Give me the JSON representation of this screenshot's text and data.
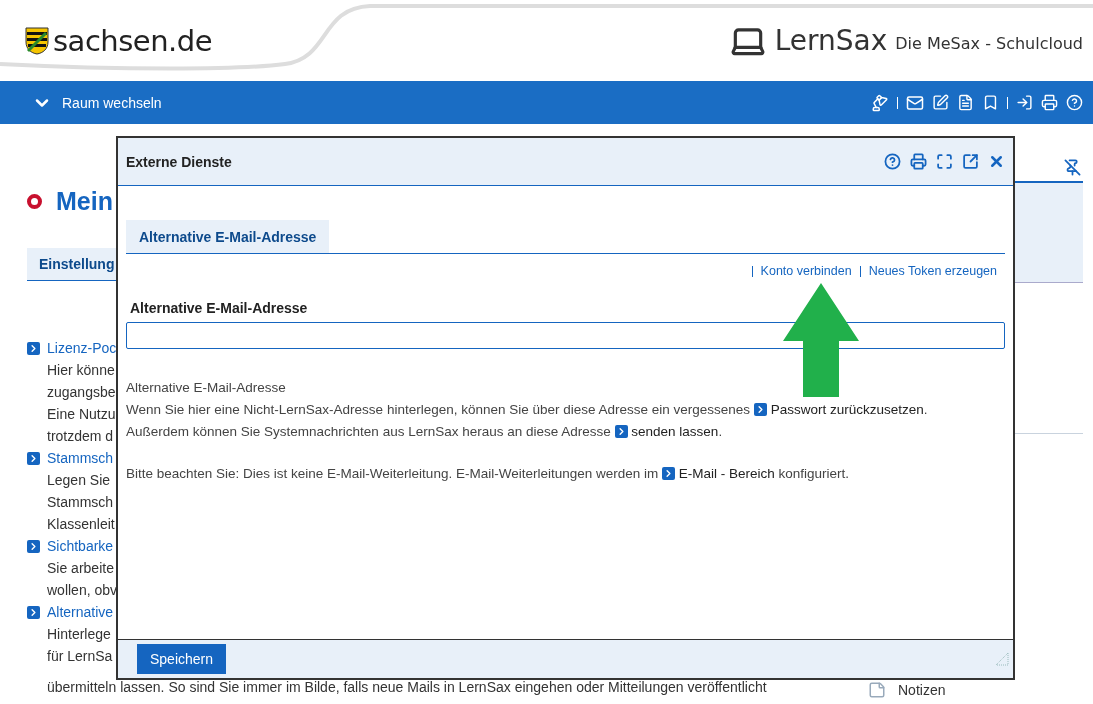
{
  "header": {
    "site_logo": "sachsen.de",
    "app_name": "LernSax",
    "tagline": "Die MeSax - Schulcloud"
  },
  "navbar": {
    "room_switch": "Raum wechseln"
  },
  "page": {
    "heading": "Mein",
    "tab": "Einstellung",
    "sections": [
      {
        "title": "Lizenz-Poc",
        "lines": [
          "Hier könne",
          "zugangsbe",
          "Eine Nutzu",
          "trotzdem d"
        ]
      },
      {
        "title": "Stammsch",
        "lines": [
          "Legen Sie",
          "Stammsch",
          "Klassenleit"
        ]
      },
      {
        "title": "Sichtbarke",
        "lines": [
          "Sie arbeite",
          "wollen, obv"
        ]
      },
      {
        "title": "Alternative",
        "lines": [
          "Hinterlege",
          "für LernSa"
        ]
      }
    ],
    "tail_line": "übermitteln lassen. So sind Sie immer im Bilde, falls neue Mails in LernSax eingehen oder Mitteilungen veröffentlicht",
    "sidebar": {
      "item": "Notizen"
    }
  },
  "dialog": {
    "title": "Externe Dienste",
    "tabs": [
      {
        "label": "Alternative E-Mail-Adresse",
        "selected": true
      }
    ],
    "actions": [
      "Konto verbinden",
      "Neues Token erzeugen"
    ],
    "field": {
      "label": "Alternative E-Mail-Adresse"
    },
    "help": {
      "title": "Alternative E-Mail-Adresse",
      "paragraphs": [
        [
          [
            {
              "kind": "text",
              "text": "Wenn Sie hier eine Nicht-LernSax-Adresse hinterlegen, können Sie über diese Adresse ein vergessenes "
            },
            {
              "kind": "link",
              "text": "Passwort zurückzusetzen"
            },
            {
              "kind": "text",
              "text": "."
            }
          ],
          [
            {
              "kind": "text",
              "text": "Außerdem können Sie Systemnachrichten aus LernSax heraus an diese Adresse "
            },
            {
              "kind": "link",
              "text": "senden lassen"
            },
            {
              "kind": "text",
              "text": "."
            }
          ]
        ],
        [
          [
            {
              "kind": "text",
              "text": "Bitte beachten Sie: Dies ist keine E-Mail-Weiterleitung. E-Mail-Weiterleitungen werden im "
            },
            {
              "kind": "link",
              "text": "E-Mail - Bereich"
            },
            {
              "kind": "text",
              "text": " konfiguriert."
            }
          ]
        ]
      ]
    },
    "save_button": "Speichern"
  }
}
